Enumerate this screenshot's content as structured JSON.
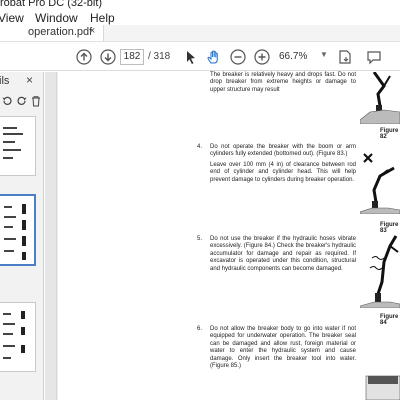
{
  "window": {
    "title": "robat Pro DC (32-bit)"
  },
  "menu": {
    "items": [
      "View",
      "Window",
      "Help"
    ]
  },
  "tab": {
    "title": "operation.pdf",
    "close": "×"
  },
  "toolbar": {
    "page_current": "182",
    "page_total": "/ 318",
    "zoom": "66.7%"
  },
  "left_panel": {
    "label": "ils",
    "close": "×"
  },
  "document": {
    "para_top": "The breaker is relatively heavy and drops fast. Do not drop breaker from extreme heights or damage to upper structure may result",
    "items": [
      {
        "number": "4.",
        "text": "Do not operate the breaker with the boom or arm cylinders fully extended (bottomed out). (Figure 83.)"
      },
      {
        "number": "",
        "text": "Leave over 100 mm (4 in) of clearance between rod end of cylinder and cylinder head. This will help prevent damage to cylinders during breaker operation."
      },
      {
        "number": "5.",
        "text": "Do not use the breaker if the hydraulic hoses vibrate excessively. (Figure 84.) Check the breaker's hydraulic accumulator for damage and repair as required. If excavator is operated under this condition, structural and hydraulic components can become damaged."
      },
      {
        "number": "6.",
        "text": "Do not allow the breaker body to go into water if not equipped for underwater operation. The breaker seal can be damaged and allow rust, foreign material or water to enter the hydraulic system and cause damage. Only insert the breaker tool into water. (Figure 85.)"
      }
    ],
    "figures": [
      "Figure 82",
      "Figure 83",
      "Figure 84"
    ]
  }
}
